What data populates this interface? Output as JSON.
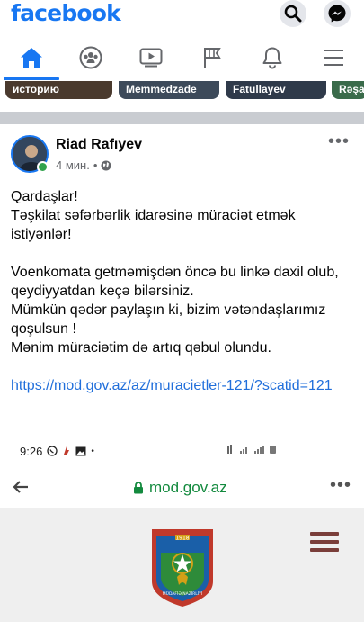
{
  "header": {
    "logo": "facebook",
    "search_icon": "search-icon",
    "messenger_icon": "messenger-icon"
  },
  "nav": {
    "tabs": [
      {
        "icon": "home-icon",
        "active": true
      },
      {
        "icon": "groups-icon",
        "active": false
      },
      {
        "icon": "watch-icon",
        "active": false
      },
      {
        "icon": "pages-flag-icon",
        "active": false
      },
      {
        "icon": "notifications-bell-icon",
        "active": false
      },
      {
        "icon": "menu-icon",
        "active": false
      }
    ]
  },
  "stories": [
    {
      "label": "историю"
    },
    {
      "label": "Memmedzade"
    },
    {
      "label": "Fatullayev"
    },
    {
      "label": "Rəşa"
    }
  ],
  "post": {
    "author": "Riad Rafıyev",
    "time": "4 мин.",
    "separator": "•",
    "privacy_icon": "globe-icon",
    "more": "•••",
    "paragraphs": [
      "Qardaşlar!\nTəşkilat səfərbərlik idarəsinə müraciət etmək istiyənlər!",
      "Voenkomata getməmişdən öncə bu linkə daxil olub, qeydiyyatdan keçə bilərsiniz.\nMümkün qədər paylaşın ki, bizim vətəndaşlarımız qoşulsun !\nMənim müraciətim də artıq qəbul olundu."
    ],
    "link": "https://mod.gov.az/az/muracietler-121/?scatid=121"
  },
  "embedded": {
    "status_time": "9:26",
    "browser_url": "mod.gov.az",
    "emblem_year": "1918",
    "emblem_text": "MÜDAFİƏ NAZİRLİYİ"
  },
  "colors": {
    "brand": "#1877f2",
    "link": "#216fdb",
    "online": "#31a24c",
    "url_green": "#138a3e"
  }
}
